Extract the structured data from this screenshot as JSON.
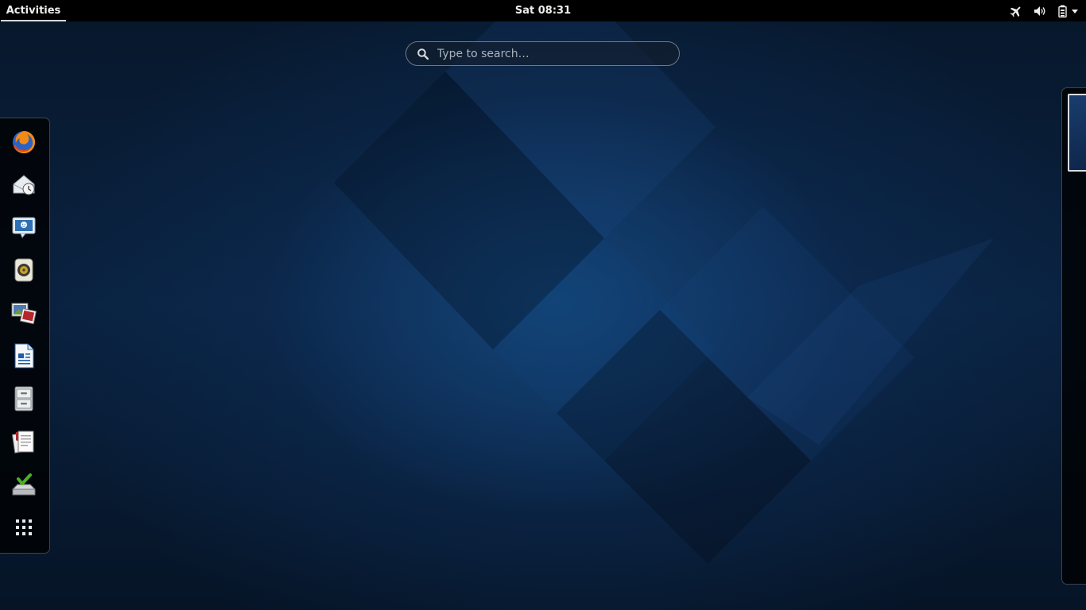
{
  "top_bar": {
    "activities_label": "Activities",
    "clock_label": "Sat 08:31",
    "status_icons": [
      "airplane-mode-icon",
      "volume-icon",
      "battery-icon",
      "dropdown-arrow-icon"
    ]
  },
  "search": {
    "placeholder": "Type to search…",
    "value": ""
  },
  "dash": {
    "items": [
      {
        "name": "firefox-icon"
      },
      {
        "name": "evolution-mail-icon"
      },
      {
        "name": "empathy-chat-icon"
      },
      {
        "name": "rhythmbox-music-icon"
      },
      {
        "name": "shotwell-photos-icon"
      },
      {
        "name": "libreoffice-writer-icon"
      },
      {
        "name": "files-cabinet-icon"
      },
      {
        "name": "document-viewer-icon"
      },
      {
        "name": "software-install-icon"
      },
      {
        "name": "show-applications-grid-icon"
      }
    ]
  },
  "colors": {
    "top_bar_bg": "#000000",
    "top_bar_text": "#eeeeec",
    "wallpaper_blue": "#0a2240",
    "dash_border": "#3b4450"
  }
}
